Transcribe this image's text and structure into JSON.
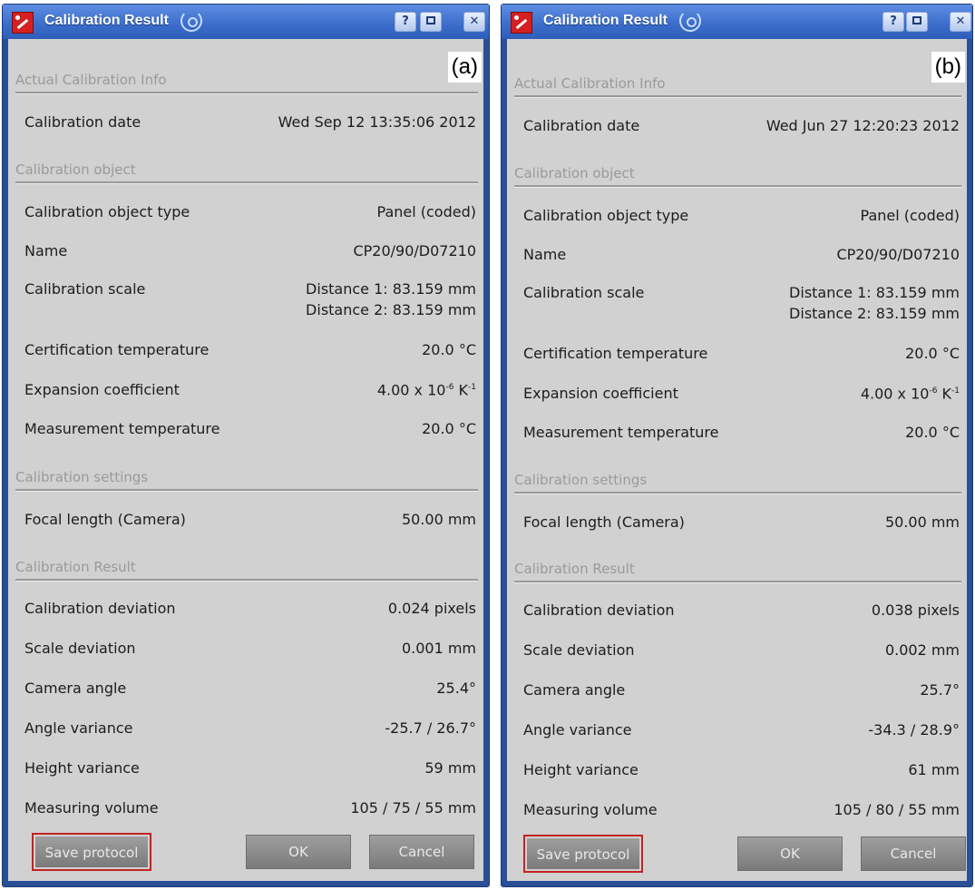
{
  "windows": [
    {
      "panel_label": "(a)",
      "title": "Calibration Result",
      "titlebar_buttons": {
        "help": "?"
      },
      "sections": {
        "actual_info": "Actual Calibration Info",
        "calibration_object": "Calibration object",
        "calibration_settings": "Calibration settings",
        "calibration_result": "Calibration Result"
      },
      "rows": {
        "calibration_date": {
          "label": "Calibration date",
          "value": "Wed Sep 12 13:35:06 2012"
        },
        "object_type": {
          "label": "Calibration object type",
          "value": "Panel (coded)"
        },
        "name": {
          "label": "Name",
          "value": "CP20/90/D07210"
        },
        "scale": {
          "label": "Calibration scale",
          "value1": "Distance 1: 83.159 mm",
          "value2": "Distance 2: 83.159 mm"
        },
        "cert_temp": {
          "label": "Certification temperature",
          "value": "20.0 °C"
        },
        "expansion": {
          "label": "Expansion coefficient",
          "base": "4.00 x 10",
          "exp": "-6",
          "unit": " K",
          "unit_exp": "-1"
        },
        "meas_temp": {
          "label": "Measurement temperature",
          "value": "20.0 °C"
        },
        "focal_length": {
          "label": "Focal length (Camera)",
          "value": "50.00 mm"
        },
        "cal_dev": {
          "label": "Calibration deviation",
          "value": "0.024 pixels"
        },
        "scale_dev": {
          "label": "Scale deviation",
          "value": "0.001 mm"
        },
        "cam_angle": {
          "label": "Camera angle",
          "value": "25.4°"
        },
        "angle_var": {
          "label": "Angle variance",
          "value": "-25.7 / 26.7°"
        },
        "height_var": {
          "label": "Height variance",
          "value": "59 mm"
        },
        "meas_vol": {
          "label": "Measuring volume",
          "value": "105 / 75 / 55 mm"
        }
      },
      "buttons": {
        "save": "Save protocol",
        "ok": "OK",
        "cancel": "Cancel"
      }
    },
    {
      "panel_label": "(b)",
      "title": "Calibration Result",
      "titlebar_buttons": {
        "help": "?"
      },
      "sections": {
        "actual_info": "Actual Calibration Info",
        "calibration_object": "Calibration object",
        "calibration_settings": "Calibration settings",
        "calibration_result": "Calibration Result"
      },
      "rows": {
        "calibration_date": {
          "label": "Calibration date",
          "value": "Wed Jun 27 12:20:23 2012"
        },
        "object_type": {
          "label": "Calibration object type",
          "value": "Panel (coded)"
        },
        "name": {
          "label": "Name",
          "value": "CP20/90/D07210"
        },
        "scale": {
          "label": "Calibration scale",
          "value1": "Distance 1: 83.159 mm",
          "value2": "Distance 2: 83.159 mm"
        },
        "cert_temp": {
          "label": "Certification temperature",
          "value": "20.0 °C"
        },
        "expansion": {
          "label": "Expansion coefficient",
          "base": "4.00 x 10",
          "exp": "-6",
          "unit": " K",
          "unit_exp": "-1"
        },
        "meas_temp": {
          "label": "Measurement temperature",
          "value": "20.0 °C"
        },
        "focal_length": {
          "label": "Focal length (Camera)",
          "value": "50.00 mm"
        },
        "cal_dev": {
          "label": "Calibration deviation",
          "value": "0.038 pixels"
        },
        "scale_dev": {
          "label": "Scale deviation",
          "value": "0.002 mm"
        },
        "cam_angle": {
          "label": "Camera angle",
          "value": "25.7°"
        },
        "angle_var": {
          "label": "Angle variance",
          "value": "-34.3 / 28.9°"
        },
        "height_var": {
          "label": "Height variance",
          "value": "61 mm"
        },
        "meas_vol": {
          "label": "Measuring volume",
          "value": "105 / 80 / 55 mm"
        }
      },
      "buttons": {
        "save": "Save protocol",
        "ok": "OK",
        "cancel": "Cancel"
      }
    }
  ]
}
